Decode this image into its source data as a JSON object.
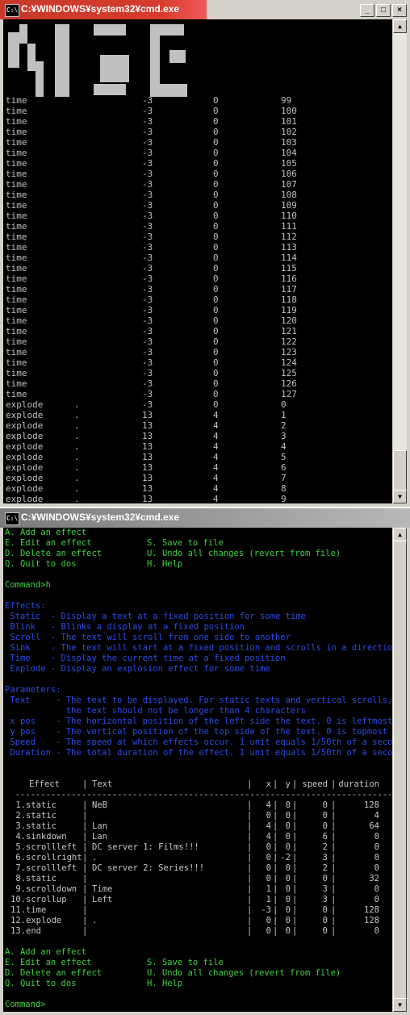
{
  "window1": {
    "title": "C:¥WINDOWS¥system32¥cmd.exe",
    "icon_label": "C:\\",
    "controls": [
      "minimize-icon",
      "maximize-icon",
      "close-icon"
    ],
    "rows": [
      {
        "name": "time",
        "dot": "",
        "x": "-3",
        "y": "0",
        "v": "99"
      },
      {
        "name": "time",
        "dot": "",
        "x": "-3",
        "y": "0",
        "v": "100"
      },
      {
        "name": "time",
        "dot": "",
        "x": "-3",
        "y": "0",
        "v": "101"
      },
      {
        "name": "time",
        "dot": "",
        "x": "-3",
        "y": "0",
        "v": "102"
      },
      {
        "name": "time",
        "dot": "",
        "x": "-3",
        "y": "0",
        "v": "103"
      },
      {
        "name": "time",
        "dot": "",
        "x": "-3",
        "y": "0",
        "v": "104"
      },
      {
        "name": "time",
        "dot": "",
        "x": "-3",
        "y": "0",
        "v": "105"
      },
      {
        "name": "time",
        "dot": "",
        "x": "-3",
        "y": "0",
        "v": "106"
      },
      {
        "name": "time",
        "dot": "",
        "x": "-3",
        "y": "0",
        "v": "107"
      },
      {
        "name": "time",
        "dot": "",
        "x": "-3",
        "y": "0",
        "v": "108"
      },
      {
        "name": "time",
        "dot": "",
        "x": "-3",
        "y": "0",
        "v": "109"
      },
      {
        "name": "time",
        "dot": "",
        "x": "-3",
        "y": "0",
        "v": "110"
      },
      {
        "name": "time",
        "dot": "",
        "x": "-3",
        "y": "0",
        "v": "111"
      },
      {
        "name": "time",
        "dot": "",
        "x": "-3",
        "y": "0",
        "v": "112"
      },
      {
        "name": "time",
        "dot": "",
        "x": "-3",
        "y": "0",
        "v": "113"
      },
      {
        "name": "time",
        "dot": "",
        "x": "-3",
        "y": "0",
        "v": "114"
      },
      {
        "name": "time",
        "dot": "",
        "x": "-3",
        "y": "0",
        "v": "115"
      },
      {
        "name": "time",
        "dot": "",
        "x": "-3",
        "y": "0",
        "v": "116"
      },
      {
        "name": "time",
        "dot": "",
        "x": "-3",
        "y": "0",
        "v": "117"
      },
      {
        "name": "time",
        "dot": "",
        "x": "-3",
        "y": "0",
        "v": "118"
      },
      {
        "name": "time",
        "dot": "",
        "x": "-3",
        "y": "0",
        "v": "119"
      },
      {
        "name": "time",
        "dot": "",
        "x": "-3",
        "y": "0",
        "v": "120"
      },
      {
        "name": "time",
        "dot": "",
        "x": "-3",
        "y": "0",
        "v": "121"
      },
      {
        "name": "time",
        "dot": "",
        "x": "-3",
        "y": "0",
        "v": "122"
      },
      {
        "name": "time",
        "dot": "",
        "x": "-3",
        "y": "0",
        "v": "123"
      },
      {
        "name": "time",
        "dot": "",
        "x": "-3",
        "y": "0",
        "v": "124"
      },
      {
        "name": "time",
        "dot": "",
        "x": "-3",
        "y": "0",
        "v": "125"
      },
      {
        "name": "time",
        "dot": "",
        "x": "-3",
        "y": "0",
        "v": "126"
      },
      {
        "name": "time",
        "dot": "",
        "x": "-3",
        "y": "0",
        "v": "127"
      },
      {
        "name": "explode",
        "dot": ".",
        "x": "-3",
        "y": "0",
        "v": "0"
      },
      {
        "name": "explode",
        "dot": ".",
        "x": "13",
        "y": "4",
        "v": "1"
      },
      {
        "name": "explode",
        "dot": ".",
        "x": "13",
        "y": "4",
        "v": "2"
      },
      {
        "name": "explode",
        "dot": ".",
        "x": "13",
        "y": "4",
        "v": "3"
      },
      {
        "name": "explode",
        "dot": ".",
        "x": "13",
        "y": "4",
        "v": "4"
      },
      {
        "name": "explode",
        "dot": ".",
        "x": "13",
        "y": "4",
        "v": "5"
      },
      {
        "name": "explode",
        "dot": ".",
        "x": "13",
        "y": "4",
        "v": "6"
      },
      {
        "name": "explode",
        "dot": ".",
        "x": "13",
        "y": "4",
        "v": "7"
      },
      {
        "name": "explode",
        "dot": ".",
        "x": "13",
        "y": "4",
        "v": "8"
      },
      {
        "name": "explode",
        "dot": ".",
        "x": "13",
        "y": "4",
        "v": "9"
      }
    ]
  },
  "window2": {
    "title": "C:¥WINDOWS¥system32¥cmd.exe",
    "icon_label": "C:\\",
    "menu_top": [
      {
        "left": "A. Add an effect",
        "right": ""
      },
      {
        "left": "E. Edit an effect",
        "right": "S. Save to file"
      },
      {
        "left": "D. Delete an effect",
        "right": "U. Undo all changes (revert from file)"
      },
      {
        "left": "Q. Quit to dos",
        "right": "H. Help"
      }
    ],
    "prompt1": "Command>h",
    "effects_heading": "Effects:",
    "effects": [
      " Static  - Display a text at a fixed position for some time",
      " Blink   - Blinks a display at a fixed position",
      " Scroll  - The text will scroll from one side to another",
      " Sink    - The text will start at a fixed position and scrolls in a direction",
      " Time    - Display the current time at a fixed position",
      " Explode - Display an explosion effect for some time"
    ],
    "params_heading": "Parameters:",
    "params": [
      " Text     - The text to be displayed. For static texts and vertical scrolls,",
      "            the text should not be longer than 4 characters",
      " x pos    - The horizontal position of the left side the text. 0 is leftmost",
      " y pos    - The vertical position of the top side of the text. 0 is topmost",
      " Speed    - The speed at which effects occur. 1 unit equals 1/50th of a second.",
      " Duration - The total duration of the effect. 1 unit equals 1/50th of a second."
    ],
    "table": {
      "headers": {
        "effect": "Effect",
        "text": "Text",
        "x": "x",
        "y": "y",
        "speed": "speed",
        "duration": "duration"
      },
      "rows": [
        {
          "n": "1.",
          "effect": "static",
          "text": "NeB",
          "x": "4",
          "y": "0",
          "speed": "0",
          "duration": "128"
        },
        {
          "n": "2.",
          "effect": "static",
          "text": "",
          "x": "0",
          "y": "0",
          "speed": "0",
          "duration": "4"
        },
        {
          "n": "3.",
          "effect": "static",
          "text": "Lan",
          "x": "4",
          "y": "0",
          "speed": "0",
          "duration": "64"
        },
        {
          "n": "4.",
          "effect": "sinkdown",
          "text": "Lan",
          "x": "4",
          "y": "0",
          "speed": "6",
          "duration": "0"
        },
        {
          "n": "5.",
          "effect": "scrollleft",
          "text": "DC server 1: Films!!!",
          "x": "0",
          "y": "0",
          "speed": "2",
          "duration": "0"
        },
        {
          "n": "6.",
          "effect": "scrollright",
          "text": ".",
          "x": "0",
          "y": "-2",
          "speed": "3",
          "duration": "0"
        },
        {
          "n": "7.",
          "effect": "scrollleft",
          "text": "DC server 2: Series!!!",
          "x": "0",
          "y": "0",
          "speed": "2",
          "duration": "0"
        },
        {
          "n": "8.",
          "effect": "static",
          "text": "",
          "x": "0",
          "y": "0",
          "speed": "0",
          "duration": "32"
        },
        {
          "n": "9.",
          "effect": "scrolldown",
          "text": "Time",
          "x": "1",
          "y": "0",
          "speed": "3",
          "duration": "0"
        },
        {
          "n": "10.",
          "effect": "scrollup",
          "text": "Left",
          "x": "1",
          "y": "0",
          "speed": "3",
          "duration": "0"
        },
        {
          "n": "11.",
          "effect": "time",
          "text": "",
          "x": "-3",
          "y": "0",
          "speed": "0",
          "duration": "128"
        },
        {
          "n": "12.",
          "effect": "explode",
          "text": ".",
          "x": "0",
          "y": "0",
          "speed": "0",
          "duration": "128"
        },
        {
          "n": "13.",
          "effect": "end",
          "text": "",
          "x": "0",
          "y": "0",
          "speed": "0",
          "duration": "0"
        }
      ]
    },
    "menu_bottom": [
      {
        "left": "A. Add an effect",
        "right": ""
      },
      {
        "left": "E. Edit an effect",
        "right": "S. Save to file"
      },
      {
        "left": "D. Delete an effect",
        "right": "U. Undo all changes (revert from file)"
      },
      {
        "left": "Q. Quit to dos",
        "right": "H. Help"
      }
    ],
    "prompt2": "Command>"
  }
}
